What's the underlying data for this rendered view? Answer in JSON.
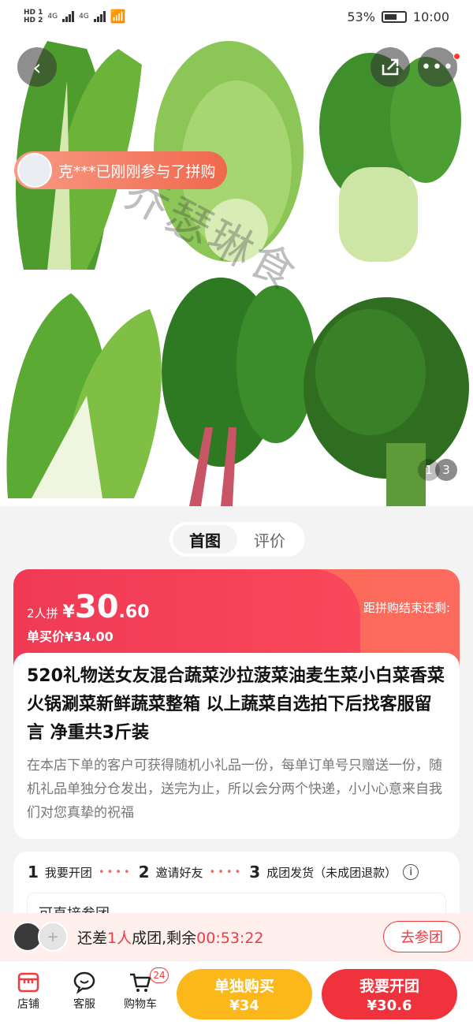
{
  "status": {
    "sim1": "HD 1",
    "sim2": "HD 2",
    "net1": "4G",
    "net2": "4G",
    "battery": "53%",
    "time": "10:00"
  },
  "hero": {
    "watermark": "乔瑟琳食",
    "toast": "克***已刚刚参与了拼购",
    "page_current": "1",
    "page_total": "3"
  },
  "tabs": [
    {
      "label": "首图"
    },
    {
      "label": "评价"
    }
  ],
  "price": {
    "group_size": "2人拼",
    "currency": "¥",
    "integer": "30",
    "decimal": ".60",
    "single_label": "单买价¥34.00",
    "countdown_label": "距拼购结束还剩:"
  },
  "product": {
    "title": "520礼物送女友混合蔬菜沙拉菠菜油麦生菜小白菜香菜火锅涮菜新鲜蔬菜整箱 以上蔬菜自选拍下后找客服留言 净重共3斤装",
    "description": "在本店下单的客户可获得随机小礼品一份，每单订单号只赠送一份，随机礼品单独分仓发出，送完为止，所以会分两个快递，小小心意来自我们对您真挚的祝福"
  },
  "steps": [
    {
      "num": "1",
      "label": "我要开团"
    },
    {
      "num": "2",
      "label": "邀请好友"
    },
    {
      "num": "3",
      "label": "成团发货（未成团退款）"
    }
  ],
  "direct_join": "可直接参团",
  "group": {
    "prefix": "还差",
    "count": "1人",
    "middle": "成团,剩余",
    "timer": "00:53:22",
    "join_label": "去参团"
  },
  "bottom": {
    "shop": "店铺",
    "service": "客服",
    "cart": "购物车",
    "cart_count": "24",
    "single_buy_label": "单独购买",
    "single_buy_price": "¥34",
    "group_buy_label": "我要开团",
    "group_buy_price": "¥30.6"
  },
  "colors": {
    "accent_red": "#f03a40",
    "buy_yellow": "#fcb81a",
    "group_red": "#f0323c"
  }
}
